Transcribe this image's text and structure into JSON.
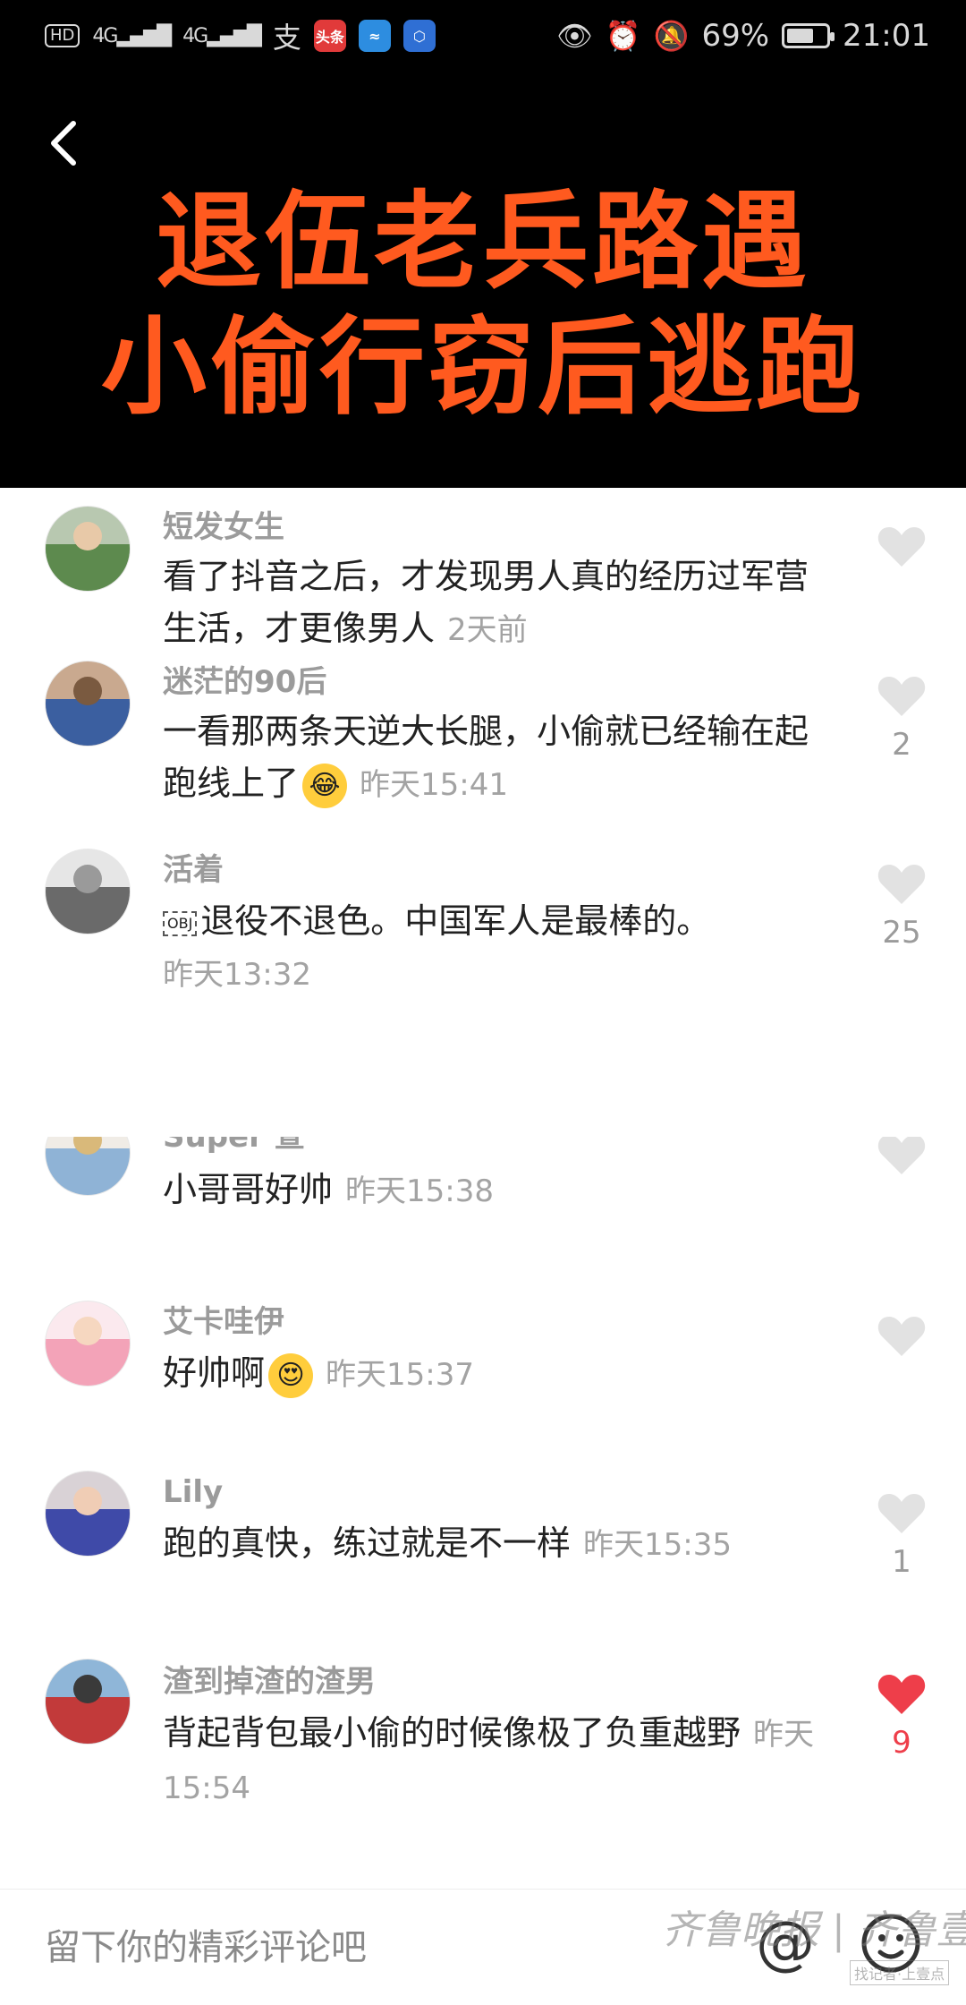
{
  "status_bar": {
    "hd_label": "HD",
    "net1": "4G",
    "net2": "4G",
    "pay_icon": "支",
    "app1_label": "头条",
    "battery_percent": "69%",
    "battery_level": 0.69,
    "time": "21:01"
  },
  "video": {
    "headline_line1": "退伍老兵路遇",
    "headline_line2": "小偷行窃后逃跑"
  },
  "comments": [
    {
      "name": "短发女生",
      "text": "看了抖音之后，才发现男人真的经历过军营生活，才更像男人",
      "time": "2天前",
      "likes": "",
      "liked": false
    },
    {
      "name": "迷茫的90后",
      "text": "一看那两条天逆大长腿，小偷就已经输在起跑线上了",
      "emoji": "laughing-tears-emoji",
      "time": "昨天15:41",
      "likes": "2",
      "liked": false
    },
    {
      "name": "活着",
      "obj": "OBJ",
      "text": "退役不退色。中国军人是最棒的。",
      "time": "昨天13:32",
      "likes": "25",
      "liked": false
    },
    {
      "name": "Super 萱",
      "text": "小哥哥好帅",
      "time": "昨天15:38",
      "likes": "",
      "liked": false
    },
    {
      "name": "艾卡哇伊",
      "text": "好帅啊",
      "emoji": "heart-eyes-emoji",
      "time": "昨天15:37",
      "likes": "",
      "liked": false
    },
    {
      "name": "Lily",
      "text": "跑的真快，练过就是不一样",
      "time": "昨天15:35",
      "likes": "1",
      "liked": false
    },
    {
      "name": "渣到掉渣的渣男",
      "text": "背起背包最小偷的时候像极了负重越野",
      "time": "昨天15:54",
      "likes": "9",
      "liked": true
    }
  ],
  "input": {
    "placeholder": "留下你的精彩评论吧",
    "value": ""
  },
  "at_label": "@",
  "watermark": "齐鲁晚报 | 齐鲁壹点",
  "watermark_sub": "找记者·上壹点",
  "colors": {
    "headline": "#ff5a1f",
    "liked": "#ee3e4a",
    "unliked": "#e2e2e2"
  }
}
